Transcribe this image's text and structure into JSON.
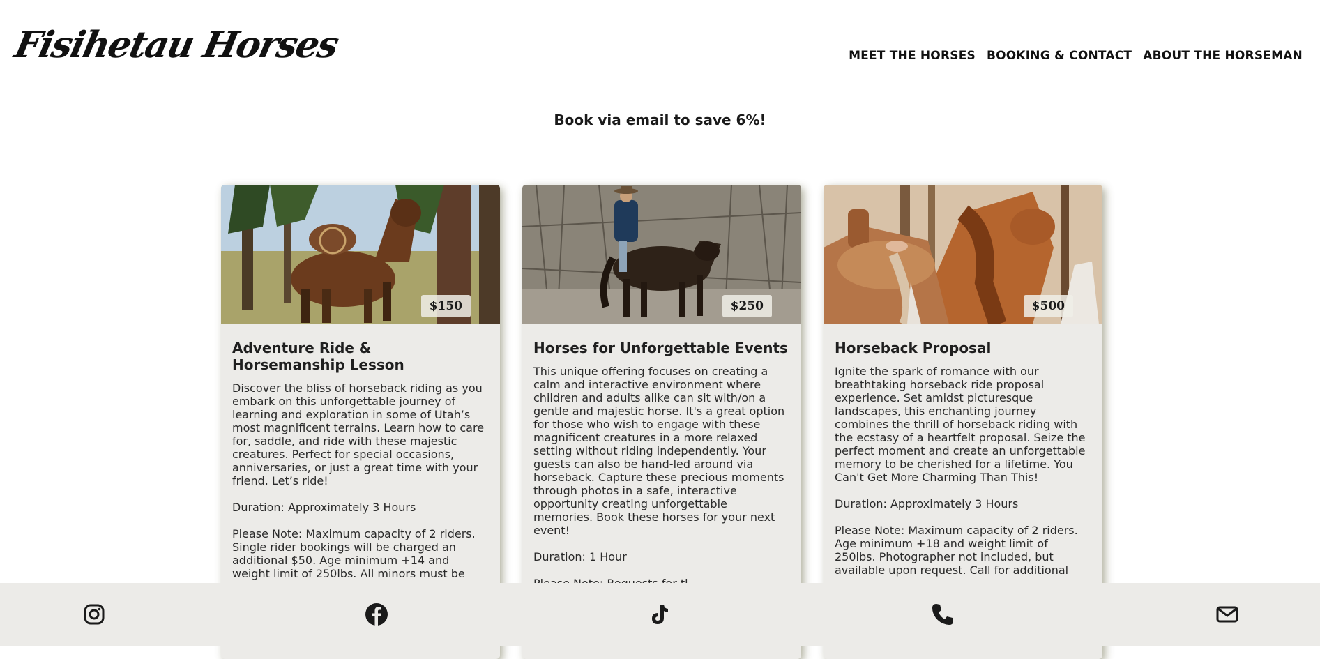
{
  "header": {
    "logo_text": "Fisihetau Horses",
    "nav": [
      {
        "label": "MEET THE HORSES"
      },
      {
        "label": "BOOKING & CONTACT"
      },
      {
        "label": "ABOUT THE HORSEMAN"
      }
    ]
  },
  "promo": "Book via email to save 6%!",
  "cards": [
    {
      "price": "$150",
      "title": "Adventure Ride & Horsemanship Lesson",
      "description": "Discover the bliss of horseback riding as you embark on this unforgettable journey of learning and exploration in some of Utah’s most magnificent terrains. Learn how to care for, saddle, and ride with these majestic creatures. Perfect for special occasions, anniversaries, or just a great time with your friend. Let’s ride!",
      "duration": "Duration: Approximately 3 Hours",
      "note": "Please Note: Maximum capacity of 2 riders. Single rider bookings will be charged an additional $50. Age minimum +14 and weight limit of 250lbs. All minors must be"
    },
    {
      "price": "$250",
      "title": "Horses for Unforgettable Events",
      "description": "This unique offering focuses on creating a calm and interactive environment where children and adults alike can sit with/on a gentle and majestic horse. It's a great option for those who wish to engage with these magnificent creatures in a more relaxed setting without riding independently. Your guests can also be hand-led around via horseback. Capture these precious moments through photos in a safe, interactive opportunity creating unforgettable memories. Book these horses for your next event!",
      "duration": "Duration: 1 Hour",
      "note": "Please Note: Requests for tl..."
    },
    {
      "price": "$500",
      "title": "Horseback Proposal",
      "description": "Ignite the spark of romance with our breathtaking horseback ride proposal experience. Set amidst picturesque landscapes, this enchanting journey combines the thrill of horseback riding with the ecstasy of a heartfelt proposal. Seize the perfect moment and create an unforgettable memory to be cherished for a lifetime. You Can't Get More Charming Than This!",
      "duration": "Duration: Approximately 3 Hours",
      "note": "Please Note: Maximum capacity of 2 riders. Age minimum +18 and weight limit of 250lbs. Photographer not included, but available upon request. Call for additional"
    }
  ],
  "footer": {
    "icons": [
      "instagram-icon",
      "facebook-icon",
      "tiktok-icon",
      "phone-icon",
      "email-icon"
    ]
  },
  "colors": {
    "card_bg": "#ecebe8",
    "footer_bg": "#ecebe8",
    "text": "#1a1a1a"
  }
}
